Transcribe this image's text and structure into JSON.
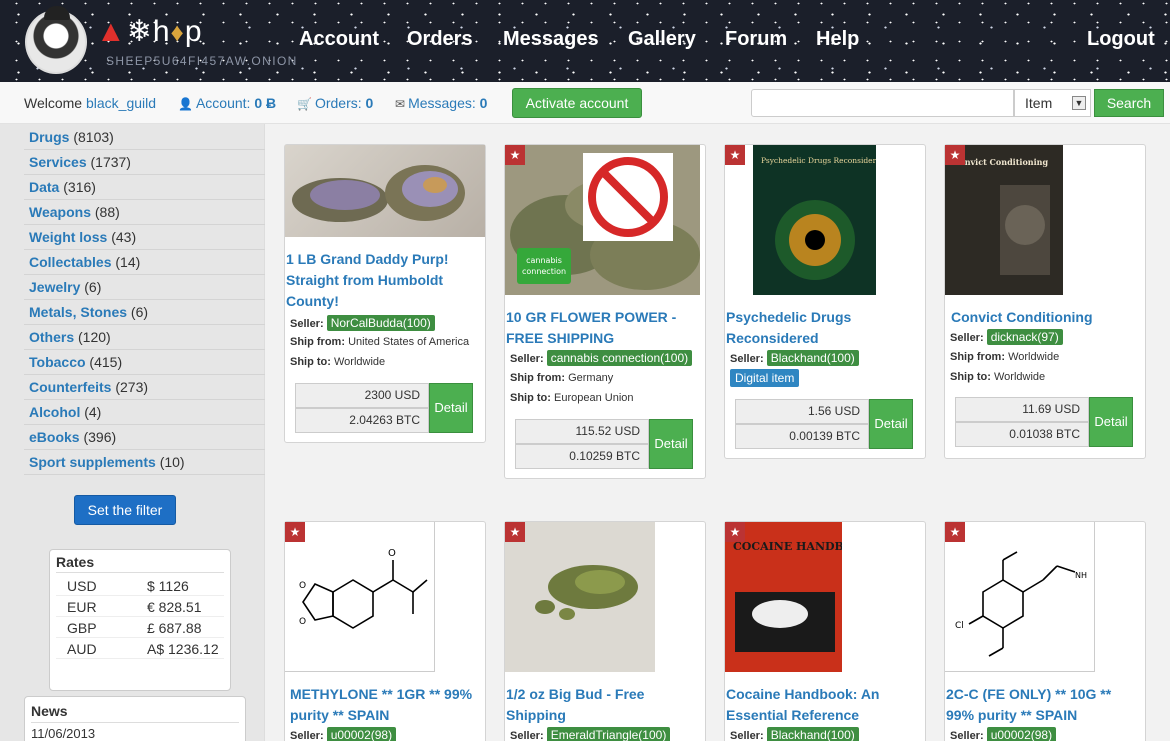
{
  "header": {
    "onion_domain": "SHEEP5U64FI457AW.ONION",
    "nav": [
      "Account",
      "Orders",
      "Messages",
      "Gallery",
      "Forum",
      "Help"
    ],
    "logout": "Logout"
  },
  "subbar": {
    "welcome": "Welcome",
    "username": "black_guild",
    "account_label": "Account:",
    "account_value": "0 Ƀ",
    "orders_label": "Orders:",
    "orders_value": "0",
    "messages_label": "Messages:",
    "messages_value": "0",
    "activate_button": "Activate account",
    "search_select": "Item",
    "search_button": "Search"
  },
  "sidebar": {
    "categories": [
      {
        "name": "Drugs",
        "count": "(8103)"
      },
      {
        "name": "Services",
        "count": "(1737)"
      },
      {
        "name": "Data",
        "count": "(316)"
      },
      {
        "name": "Weapons",
        "count": "(88)"
      },
      {
        "name": "Weight loss",
        "count": "(43)"
      },
      {
        "name": "Collectables",
        "count": "(14)"
      },
      {
        "name": "Jewelry",
        "count": "(6)"
      },
      {
        "name": "Metals, Stones",
        "count": "(6)"
      },
      {
        "name": "Others",
        "count": "(120)"
      },
      {
        "name": "Tobacco",
        "count": "(415)"
      },
      {
        "name": "Counterfeits",
        "count": "(273)"
      },
      {
        "name": "Alcohol",
        "count": "(4)"
      },
      {
        "name": "eBooks",
        "count": "(396)"
      },
      {
        "name": "Sport supplements",
        "count": "(10)"
      }
    ],
    "filter_button": "Set the filter",
    "rates_title": "Rates",
    "rates": [
      {
        "cur": "USD",
        "val": "$ 1126"
      },
      {
        "cur": "EUR",
        "val": "€ 828.51"
      },
      {
        "cur": "GBP",
        "val": "£ 687.88"
      },
      {
        "cur": "AUD",
        "val": "A$ 1236.12"
      }
    ],
    "news_title": "News",
    "news_date": "11/06/2013"
  },
  "products": [
    {
      "title": "1 LB Grand Daddy Purp! Straight from Humboldt County!",
      "seller": "NorCalBudda(100)",
      "ship_from": "United States of America",
      "ship_to": "Worldwide",
      "usd": "2300 USD",
      "btc": "2.04263 BTC"
    },
    {
      "title": "10 GR FLOWER POWER - FREE SHIPPING",
      "seller": "cannabis connection(100)",
      "ship_from": "Germany",
      "ship_to": "European Union",
      "usd": "115.52 USD",
      "btc": "0.10259 BTC",
      "img_text": "cannabis connection"
    },
    {
      "title": "Psychedelic Drugs Reconsidered",
      "seller": "Blackhand(100)",
      "tag": "Digital item",
      "usd": "1.56 USD",
      "btc": "0.00139 BTC",
      "book_title": "Psychedelic Drugs Reconsidered"
    },
    {
      "title": "Convict Conditioning",
      "seller": "dicknack(97)",
      "ship_from": "Worldwide",
      "ship_to": "Worldwide",
      "usd": "11.69 USD",
      "btc": "0.01038 BTC",
      "book_title": "Convict Conditioning"
    },
    {
      "title": "METHYLONE ** 1GR ** 99% purity ** SPAIN",
      "seller": "u00002(98)"
    },
    {
      "title": "1/2 oz Big Bud - Free Shipping",
      "seller": "EmeraldTriangle(100)"
    },
    {
      "title": "Cocaine Handbook: An Essential Reference",
      "seller": "Blackhand(100)",
      "book_title": "COCAINE HANDBOOK"
    },
    {
      "title": "2C-C (FE ONLY) ** 10G ** 99% purity ** SPAIN",
      "seller": "u00002(98)"
    }
  ],
  "labels": {
    "seller": "Seller:",
    "ship_from": "Ship from:",
    "ship_to": "Ship to:",
    "detail": "Detail"
  }
}
